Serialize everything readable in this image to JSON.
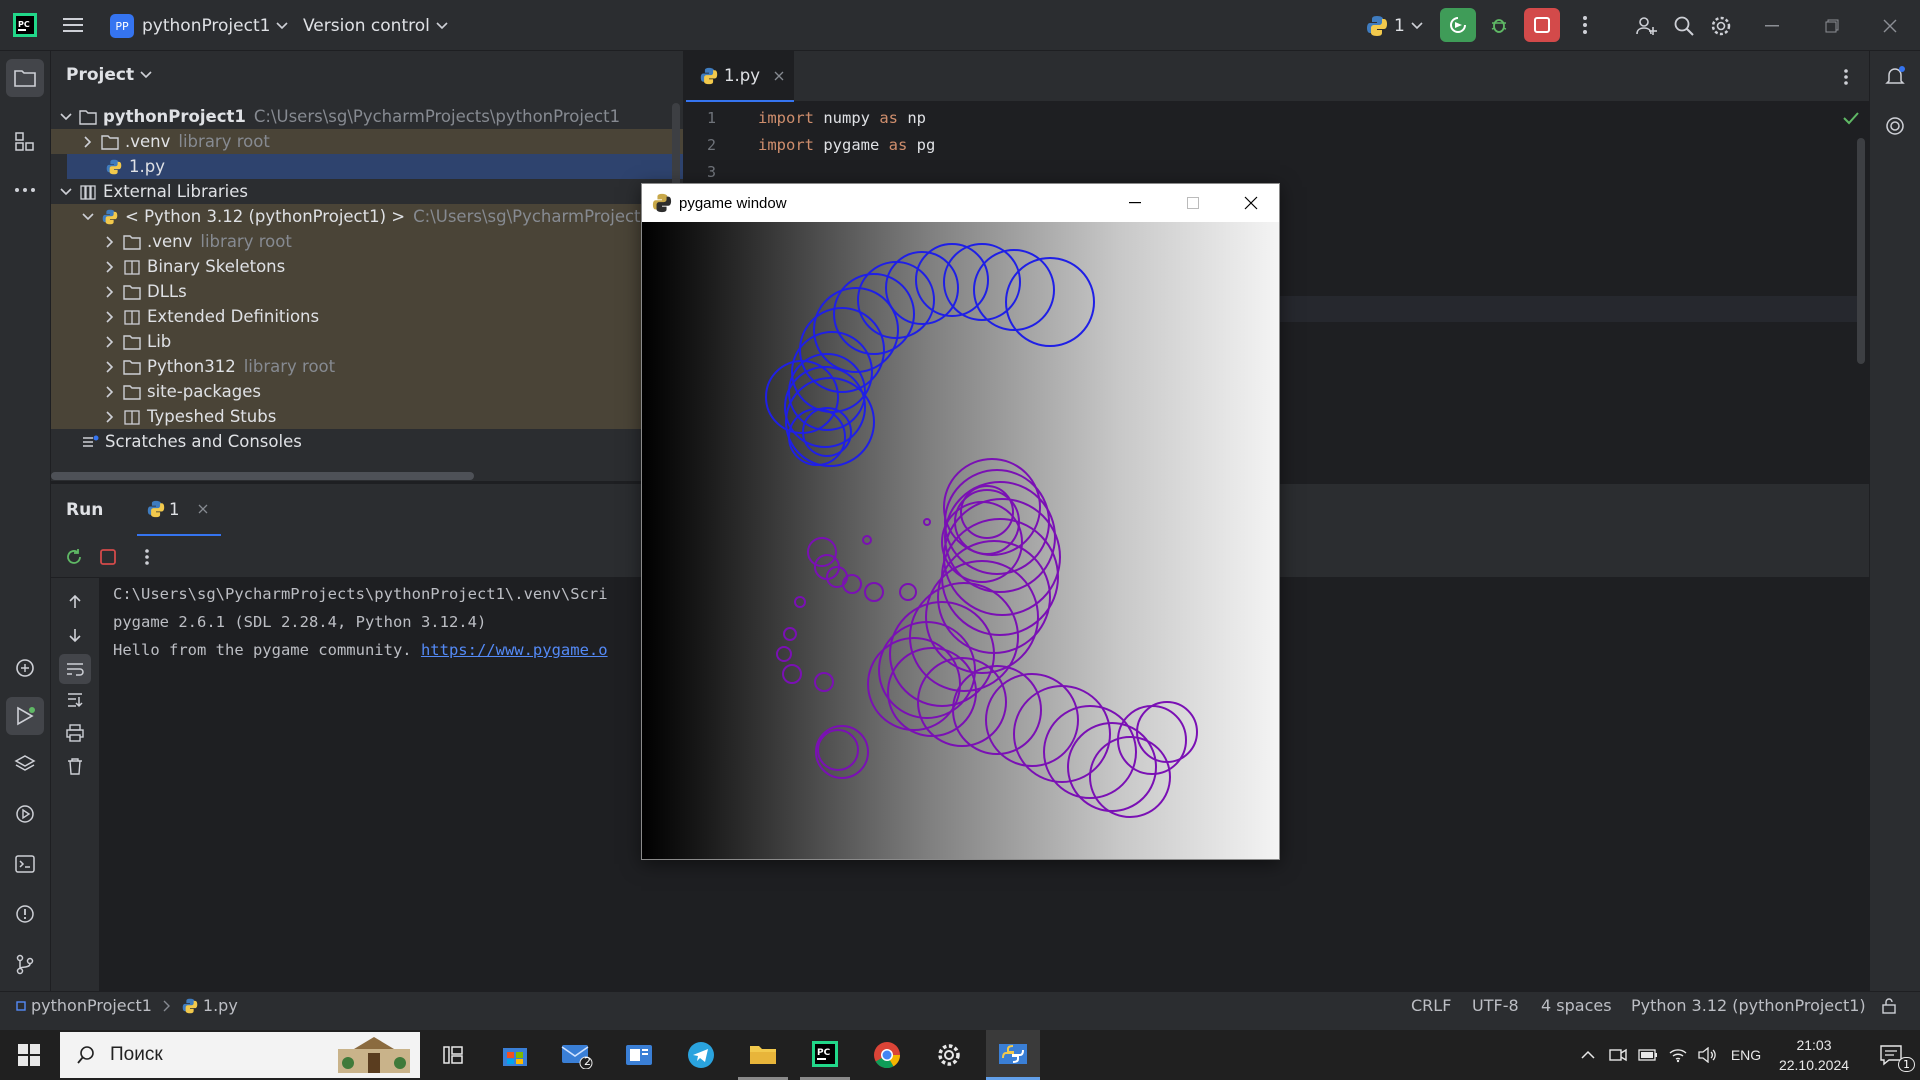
{
  "titlebar": {
    "project_badge": "PP",
    "project_name": "pythonProject1",
    "vcs_label": "Version control",
    "run_config_count": "1"
  },
  "project_panel": {
    "title": "Project",
    "rows": [
      {
        "label": "pythonProject1",
        "path": "C:\\Users\\sg\\PycharmProjects\\pythonProject1"
      },
      {
        "label": ".venv",
        "note": "library root"
      },
      {
        "label": "1.py"
      },
      {
        "label": "External Libraries"
      },
      {
        "label": "< Python 3.12 (pythonProject1) >",
        "path": "C:\\Users\\sg\\PycharmProjects\\p"
      },
      {
        "label": ".venv",
        "note": "library root"
      },
      {
        "label": "Binary Skeletons"
      },
      {
        "label": "DLLs"
      },
      {
        "label": "Extended Definitions"
      },
      {
        "label": "Lib"
      },
      {
        "label": "Python312",
        "note": "library root"
      },
      {
        "label": "site-packages"
      },
      {
        "label": "Typeshed Stubs"
      },
      {
        "label": "Scratches and Consoles"
      }
    ]
  },
  "editor": {
    "tab_label": "1.py",
    "lines": [
      {
        "num": "1",
        "kw1": "import",
        "mod": " numpy ",
        "kw2": "as",
        "alias": " np"
      },
      {
        "num": "2",
        "kw1": "import",
        "mod": " pygame ",
        "kw2": "as",
        "alias": " pg"
      },
      {
        "num": "3"
      }
    ]
  },
  "run": {
    "tab_run": "Run",
    "tab_config": "1",
    "console": [
      "C:\\Users\\sg\\PycharmProjects\\pythonProject1\\.venv\\Scri",
      "pygame 2.6.1 (SDL 2.28.4, Python 3.12.4)",
      "Hello from the pygame community. "
    ],
    "console_link": "https://www.pygame.o"
  },
  "pygame_window": {
    "title": "pygame window"
  },
  "statusbar": {
    "crumb_project": "pythonProject1",
    "crumb_file": "1.py",
    "line_sep": "CRLF",
    "encoding": "UTF-8",
    "indent": "4 spaces",
    "interpreter": "Python 3.12 (pythonProject1)"
  },
  "taskbar": {
    "search_placeholder": "Поиск",
    "mail_badge": "2",
    "lang": "ENG",
    "time": "21:03",
    "date": "22.10.2024",
    "notif_count": "1"
  },
  "colors": {
    "accent_green": "#3f9c58",
    "stop_red": "#d34a4a",
    "blue_circles": "#1f1fe6",
    "purple_circles": "#7a10b4"
  }
}
